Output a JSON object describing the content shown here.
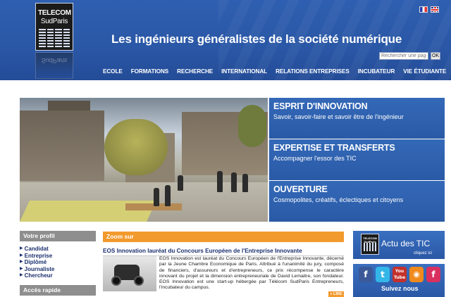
{
  "header": {
    "logo_line1": "TELECOM",
    "logo_line2": "SudParis",
    "tagline": "Les ingénieurs généralistes de la société numérique",
    "search_placeholder": "Rechercher une page",
    "search_button": "OK",
    "flags": [
      "fr-flag-icon",
      "en-flag-icon"
    ]
  },
  "nav": {
    "items": [
      {
        "label": "ECOLE"
      },
      {
        "label": "FORMATIONS"
      },
      {
        "label": "RECHERCHE"
      },
      {
        "label": "INTERNATIONAL"
      },
      {
        "label": "RELATIONS ENTREPRISES"
      },
      {
        "label": "INCUBATEUR"
      },
      {
        "label": "VIE ÉTUDIANTE"
      }
    ]
  },
  "hero": {
    "panels": [
      {
        "title": "ESPRIT D'INNOVATION",
        "subtitle": "Savoir, savoir-faire et savoir être de l'ingénieur"
      },
      {
        "title": "EXPERTISE ET TRANSFERTS",
        "subtitle": "Accompagner l'essor des TIC"
      },
      {
        "title": "OUVERTURE",
        "subtitle": "Cosmopolites, créatifs, éclectiques et citoyens"
      }
    ]
  },
  "profil": {
    "heading": "Votre profil",
    "items": [
      {
        "label": "Candidat"
      },
      {
        "label": "Entreprise"
      },
      {
        "label": "Diplômé"
      },
      {
        "label": "Journaliste"
      },
      {
        "label": "Chercheur"
      }
    ]
  },
  "acces": {
    "heading": "Accès rapide"
  },
  "zoom": {
    "heading": "Zoom sur",
    "news_title": "EOS Innovation lauréat du Concours Européen de l'Entreprise Innovante",
    "news_text": "EOS Innovation est lauréat du Concours Européen de l'Entreprise Innovante, décerné par la Jeune Chambre Economique de Paris. Attribué à l'unanimité du jury, composé de financiers, d'assureurs et d'entrepreneurs, ce prix récompense le caractère innovant du projet et la dimension entrepreneuriale de David Lemaitre, son fondateur. EOS Innovation est une start-up hébergée par Télécom SudParis Entrepreneurs, l'incubateur du campus.",
    "more_label": "» LIRE"
  },
  "actu": {
    "title": "Actu des TIC",
    "subtitle": "cliquez ici",
    "mini_logo": "TELECOM SudParis"
  },
  "social": {
    "label": "Suivez nous",
    "icons": [
      "facebook-icon",
      "twitter-icon",
      "youtube-icon",
      "rss-icon",
      "flickr-icon"
    ],
    "youtube_text": "You Tube"
  },
  "colors": {
    "header_blue": "#2a57a6",
    "panel_blue": "#2a5aa6",
    "accent_orange": "#f29a2e",
    "grey_heading": "#8e8e8e",
    "link_navy": "#1b2f6e"
  }
}
